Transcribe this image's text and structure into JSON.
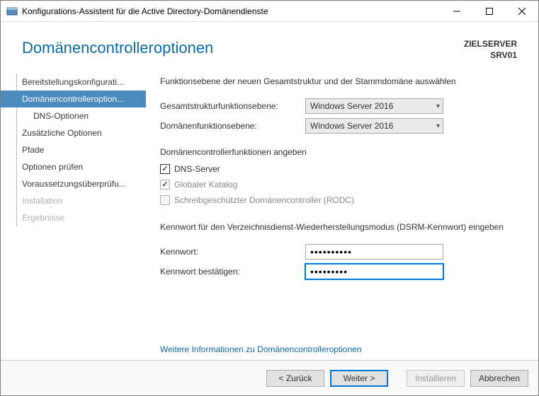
{
  "window": {
    "title": "Konfigurations-Assistent für die Active Directory-Domänendienste"
  },
  "header": {
    "page_title": "Domänencontrolleroptionen",
    "target_label": "ZIELSERVER",
    "target_server": "SRV01"
  },
  "sidebar": {
    "items": [
      {
        "label": "Bereitstellungskonfigurati...",
        "state": "normal"
      },
      {
        "label": "Domänencontrolleroption...",
        "state": "active"
      },
      {
        "label": "DNS-Optionen",
        "state": "sub"
      },
      {
        "label": "Zusätzliche Optionen",
        "state": "normal"
      },
      {
        "label": "Pfade",
        "state": "normal"
      },
      {
        "label": "Optionen prüfen",
        "state": "normal"
      },
      {
        "label": "Voraussetzungsüberprüfu...",
        "state": "normal"
      },
      {
        "label": "Installation",
        "state": "disabled"
      },
      {
        "label": "Ergebnisse",
        "state": "disabled"
      }
    ]
  },
  "content": {
    "instruction": "Funktionsebene der neuen Gesamtstruktur und der Stammdomäne auswählen",
    "forest_label": "Gesamtstrukturfunktionsebene:",
    "forest_value": "Windows Server 2016",
    "domain_label": "Domänenfunktionsebene:",
    "domain_value": "Windows Server 2016",
    "capabilities_label": "Domänencontrollerfunktionen angeben",
    "chk_dns": "DNS-Server",
    "chk_gc": "Globaler Katalog",
    "chk_rodc": "Schreibgeschützter Domänencontroller (RODC)",
    "dsrm_instruction": "Kennwort für den Verzeichnisdienst-Wiederherstellungsmodus (DSRM-Kennwort) eingeben",
    "pwd_label": "Kennwort:",
    "pwd_value": "••••••••••",
    "pwd_confirm_label": "Kennwort bestätigen:",
    "pwd_confirm_value": "•••••••••",
    "more_link": "Weitere Informationen zu Domänencontrolleroptionen"
  },
  "footer": {
    "back": "< Zurück",
    "next": "Weiter >",
    "install": "Installieren",
    "cancel": "Abbrechen"
  }
}
